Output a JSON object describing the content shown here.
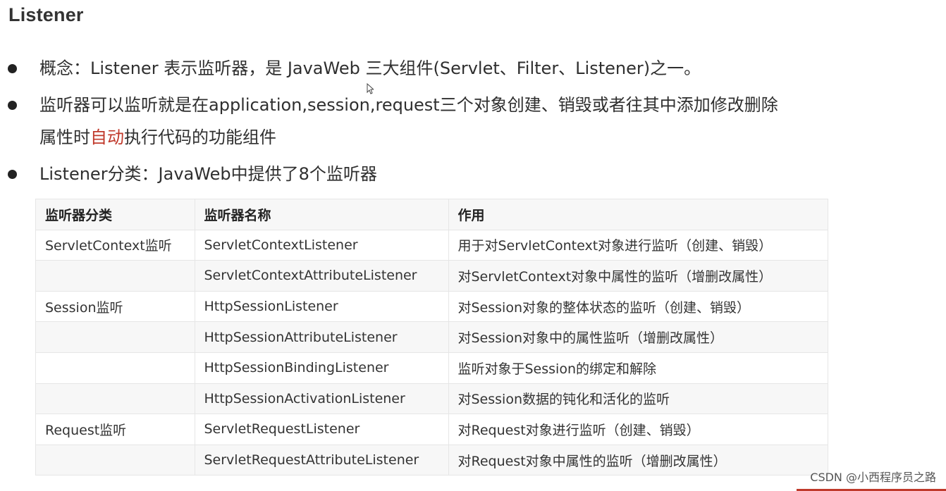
{
  "title": "Listener",
  "bullets": [
    {
      "text": "概念：Listener 表示监听器，是 JavaWeb 三大组件(Servlet、Filter、Listener)之一。"
    },
    {
      "line1": "监听器可以监听就是在application,session,request三个对象创建、销毁或者往其中添加修改删除",
      "line2_before": "属性时",
      "line2_accent": "自动",
      "line2_after": "执行代码的功能组件"
    },
    {
      "text": "Listener分类：JavaWeb中提供了8个监听器"
    }
  ],
  "table": {
    "headers": [
      "监听器分类",
      "监听器名称",
      "作用"
    ],
    "rows": [
      [
        "ServletContext监听",
        "ServletContextListener",
        "用于对ServletContext对象进行监听（创建、销毁）"
      ],
      [
        "",
        "ServletContextAttributeListener",
        "对ServletContext对象中属性的监听（增删改属性）"
      ],
      [
        "Session监听",
        "HttpSessionListener",
        "对Session对象的整体状态的监听（创建、销毁）"
      ],
      [
        "",
        "HttpSessionAttributeListener",
        "对Session对象中的属性监听（增删改属性）"
      ],
      [
        "",
        "HttpSessionBindingListener",
        "监听对象于Session的绑定和解除"
      ],
      [
        "",
        "HttpSessionActivationListener",
        "对Session数据的钝化和活化的监听"
      ],
      [
        "Request监听",
        "ServletRequestListener",
        "对Request对象进行监听（创建、销毁）"
      ],
      [
        "",
        "ServletRequestAttributeListener",
        "对Request对象中属性的监听（增删改属性）"
      ]
    ]
  },
  "watermark": "CSDN @小西程序员之路",
  "colors": {
    "accent": "#c0392b",
    "header_bg": "#f7f7f7",
    "border": "#e6e6e6"
  }
}
